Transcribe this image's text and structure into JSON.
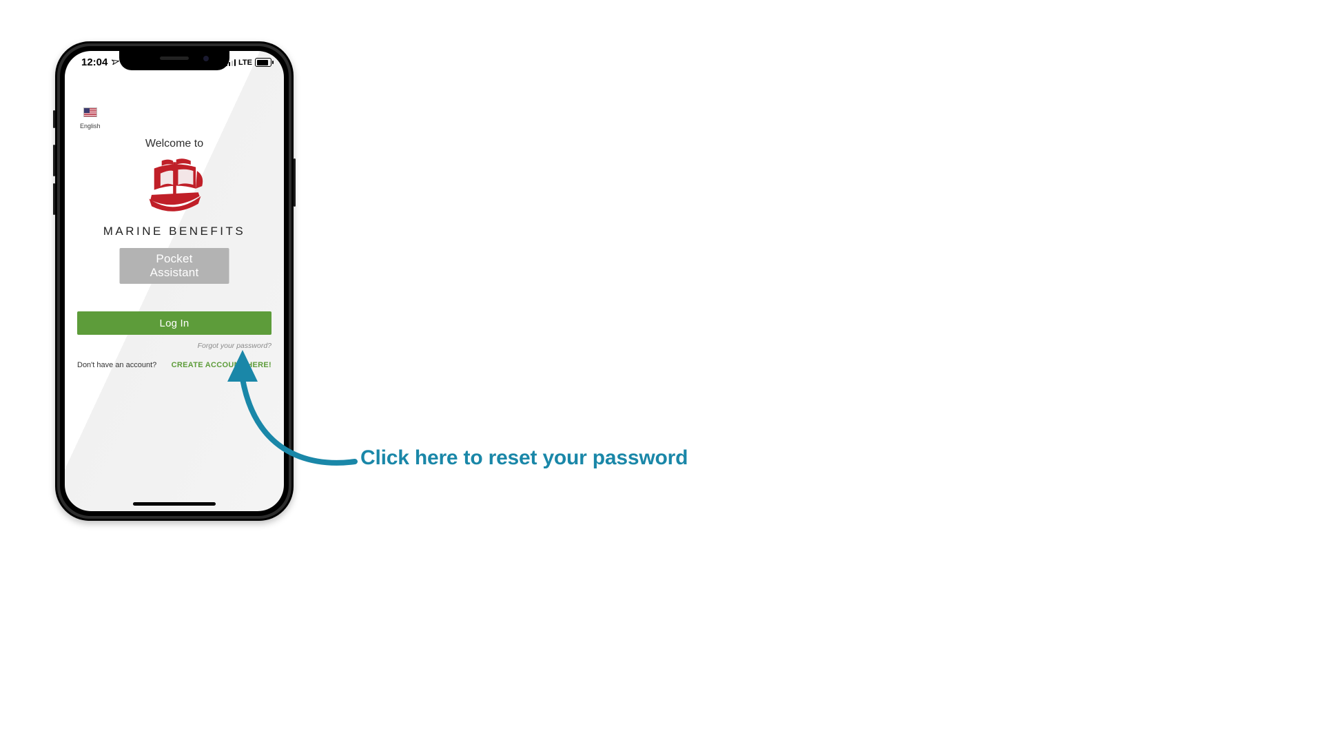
{
  "status_bar": {
    "time": "12:04",
    "network_label": "LTE"
  },
  "language": {
    "label": "English"
  },
  "welcome": "Welcome to",
  "brand": "MARINE BENEFITS",
  "buttons": {
    "pocket_assistant": "Pocket Assistant",
    "log_in": "Log In"
  },
  "links": {
    "forgot": "Forgot your password?",
    "no_account": "Don't have an account?",
    "create": "CREATE ACCOUNT HERE!"
  },
  "callout": {
    "text": "Click here to reset your password",
    "color": "#1a87a8"
  },
  "colors": {
    "accent_green": "#5d9c3a",
    "logo_red": "#c01f28",
    "callout_blue": "#1a87a8",
    "pocket_grey": "#b3b3b3"
  }
}
